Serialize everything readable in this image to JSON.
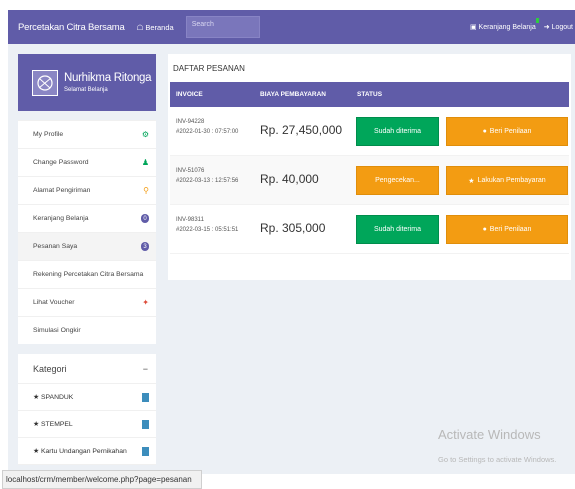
{
  "topbar": {
    "brand": "Percetakan Citra Bersama",
    "home_label": "Beranda",
    "home_icon": "home-icon",
    "search_placeholder": "Search",
    "cart_label": "Keranjang Belanja",
    "logout_label": "Logout"
  },
  "profile": {
    "name": "Nurhikma Ritonga",
    "subtitle": "Selamat Belanja"
  },
  "menu": [
    {
      "label": "My Profile",
      "icon": "gear-icon",
      "glyph": "⚙"
    },
    {
      "label": "Change Password",
      "icon": "user-icon",
      "glyph": "♟"
    },
    {
      "label": "Alamat Pengiriman",
      "icon": "map-marker-icon",
      "glyph": "⚲"
    },
    {
      "label": "Keranjang Belanja",
      "badge": "0"
    },
    {
      "label": "Pesanan Saya",
      "badge": "3"
    },
    {
      "label": "Rekening Percetakan Citra Bersama"
    },
    {
      "label": "Lihat Voucher",
      "icon": "tag-icon",
      "glyph": "♦"
    },
    {
      "label": "Simulasi Ongkir"
    }
  ],
  "categories": {
    "title": "Kategori",
    "toggle": "−",
    "items": [
      {
        "label": "SPANDUK"
      },
      {
        "label": "STEMPEL"
      },
      {
        "label": "Kartu Undangan Pernikahan"
      }
    ]
  },
  "orders": {
    "title": "DAFTAR PESANAN",
    "columns": [
      "INVOICE",
      "BIAYA PEMBAYARAN",
      "STATUS"
    ],
    "rows": [
      {
        "invoice": "INV-94228",
        "datetime": "#2022-01-30 : 07:57:00",
        "amount": "Rp. 27,450,000",
        "status": "Sudah diterima",
        "status_color": "#00a65a",
        "action": "Beri Penilaan",
        "action_icon": "comment-icon",
        "action_glyph": "●"
      },
      {
        "invoice": "INV-51076",
        "datetime": "#2022-03-13 : 12:57:56",
        "amount": "Rp. 40,000",
        "status": "Pengecekan...",
        "status_color": "#f39c12",
        "action": "Lakukan Pembayaran",
        "action_icon": "star-icon",
        "action_glyph": "★"
      },
      {
        "invoice": "INV-98311",
        "datetime": "#2022-03-15 : 05:51:51",
        "amount": "Rp. 305,000",
        "status": "Sudah diterima",
        "status_color": "#00a65a",
        "action": "Beri Penilaan",
        "action_icon": "comment-icon",
        "action_glyph": "●"
      }
    ]
  },
  "watermark": {
    "line1": "Activate Windows",
    "line2": "Go to Settings to activate Windows."
  },
  "status_url": "localhost/crm/member/welcome.php?page=pesanan"
}
